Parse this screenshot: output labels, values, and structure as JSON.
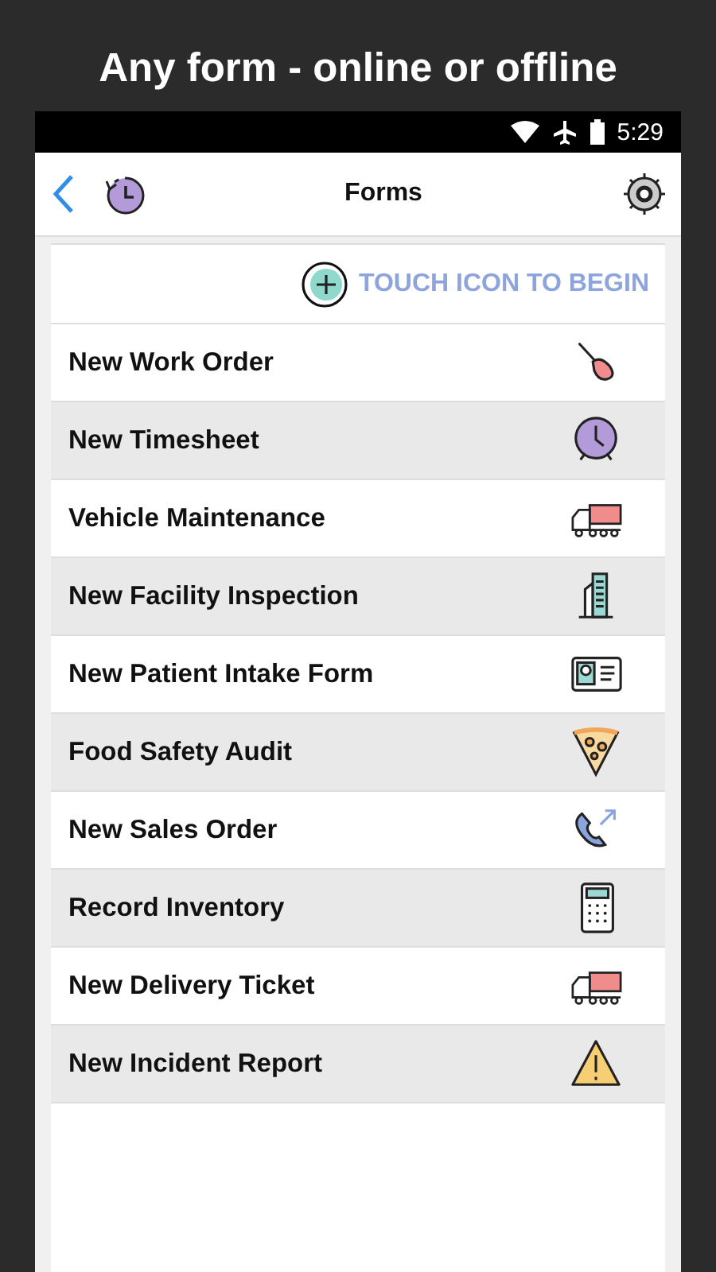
{
  "headline": "Any form - online or offline",
  "status_bar": {
    "time": "5:29"
  },
  "app_bar": {
    "title": "Forms"
  },
  "begin_hint": "TOUCH ICON TO BEGIN",
  "forms": [
    {
      "label": "New Work Order",
      "kind": "screwdriver"
    },
    {
      "label": "New Timesheet",
      "kind": "clock"
    },
    {
      "label": "Vehicle Maintenance",
      "kind": "truck"
    },
    {
      "label": "New Facility Inspection",
      "kind": "building"
    },
    {
      "label": "New Patient Intake Form",
      "kind": "idcard"
    },
    {
      "label": "Food Safety Audit",
      "kind": "pizza"
    },
    {
      "label": "New Sales Order",
      "kind": "phone"
    },
    {
      "label": "Record Inventory",
      "kind": "calculator"
    },
    {
      "label": "New Delivery Ticket",
      "kind": "truck"
    },
    {
      "label": "New Incident Report",
      "kind": "warning"
    }
  ]
}
